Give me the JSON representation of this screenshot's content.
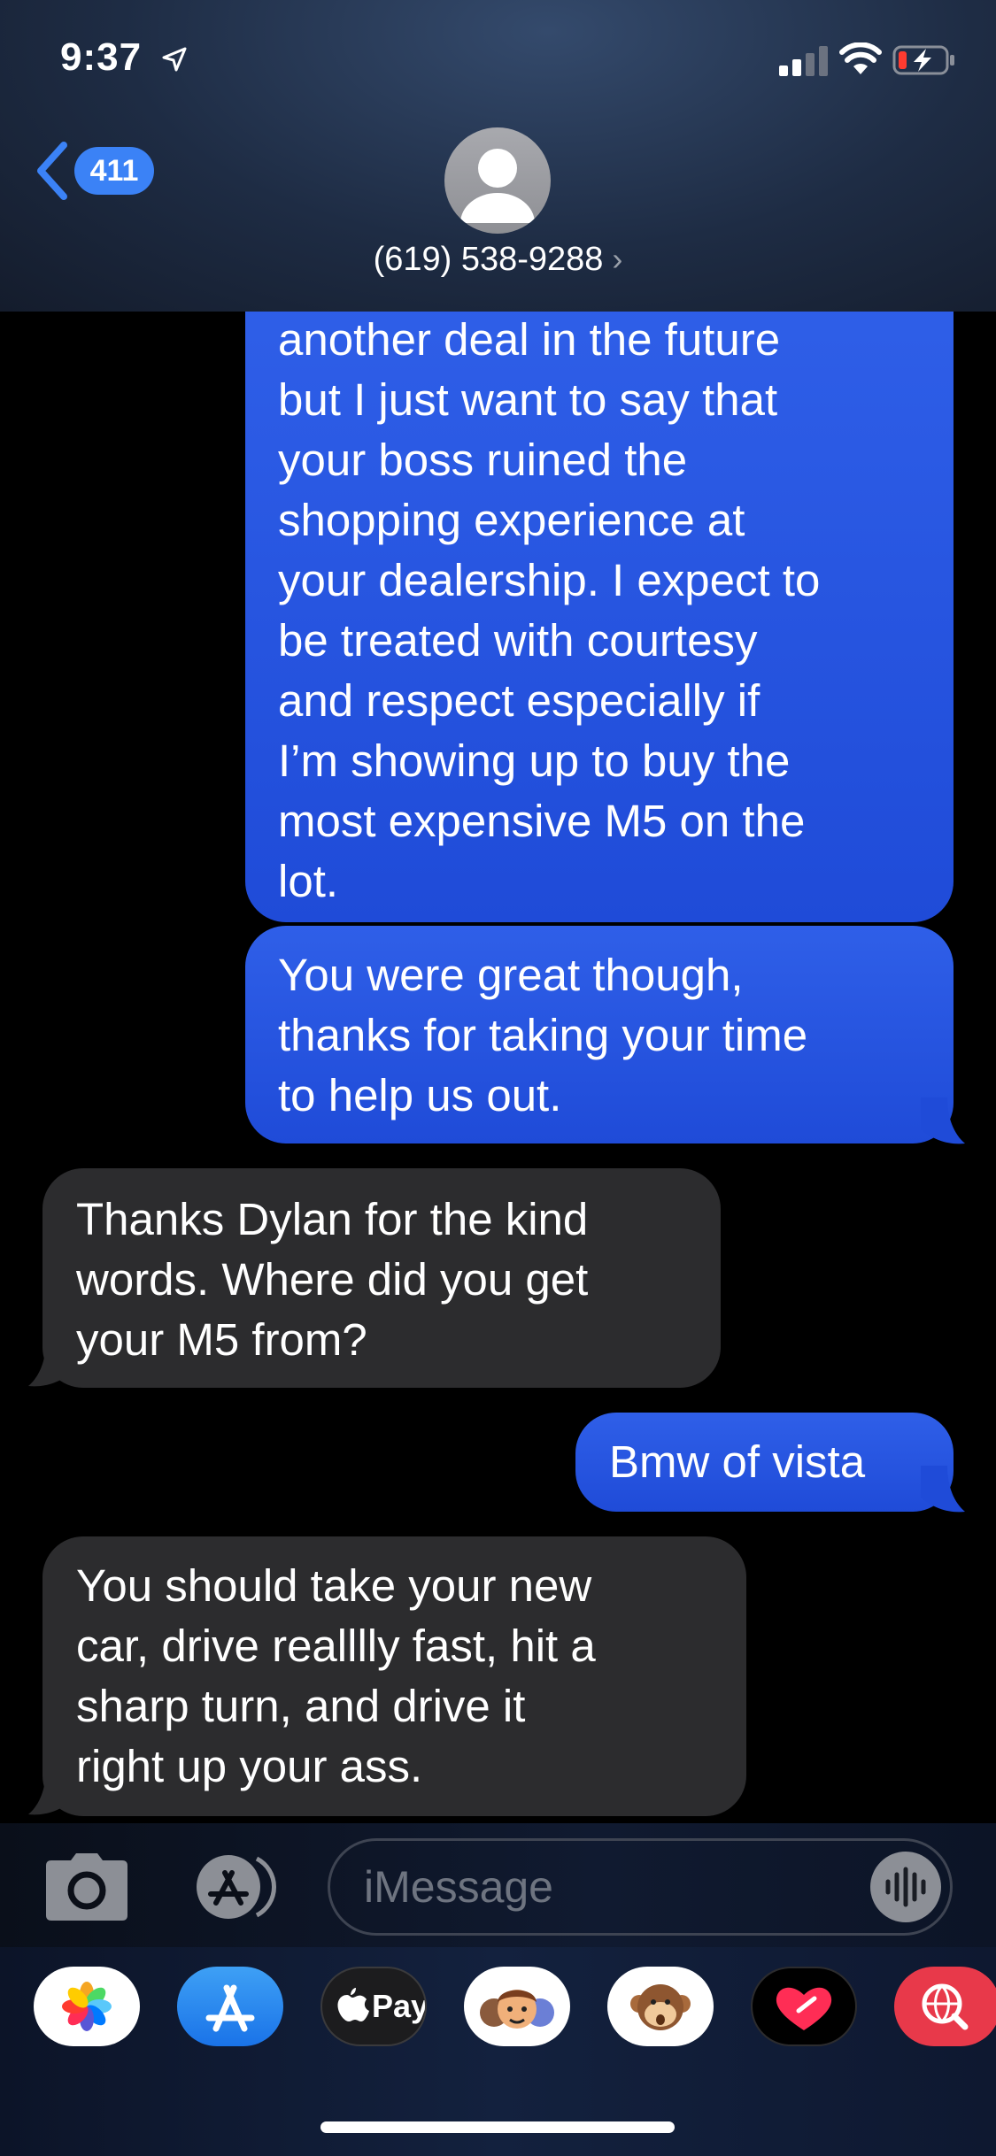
{
  "status_bar": {
    "time": "9:37"
  },
  "header": {
    "back_count": "411",
    "contact": "(619) 538-9288",
    "chevron": "›"
  },
  "messages": [
    {
      "direction": "outgoing",
      "lines": [
        "another deal in the future",
        "but I just want to say that",
        "your boss ruined the",
        "shopping experience at",
        "your dealership. I expect to",
        "be treated with courtesy",
        "and respect especially if",
        "I’m showing up to buy the",
        "most expensive M5 on the",
        "lot."
      ]
    },
    {
      "direction": "outgoing",
      "lines": [
        "You were great though,",
        "thanks for taking your time",
        "to help us out."
      ]
    },
    {
      "direction": "incoming",
      "lines": [
        "Thanks Dylan for the kind",
        "words. Where did you get",
        "your M5 from?"
      ]
    },
    {
      "direction": "outgoing",
      "lines": [
        "Bmw of vista"
      ]
    },
    {
      "direction": "incoming",
      "lines": [
        "You should take your new",
        "car, drive realllly fast, hit a",
        "sharp turn, and drive it",
        "right up your ass."
      ]
    }
  ],
  "composer": {
    "placeholder": "iMessage"
  },
  "app_drawer": {
    "apple_pay_label": "Pay",
    "apps": [
      "photos-icon",
      "app-store-icon",
      "apple-pay-icon",
      "memoji-icon",
      "animoji-monkey-icon",
      "digital-touch-icon",
      "web-search-icon"
    ]
  },
  "colors": {
    "outgoing": "#2455e0",
    "incoming": "#2c2c2e",
    "accent": "#3b82f6"
  }
}
